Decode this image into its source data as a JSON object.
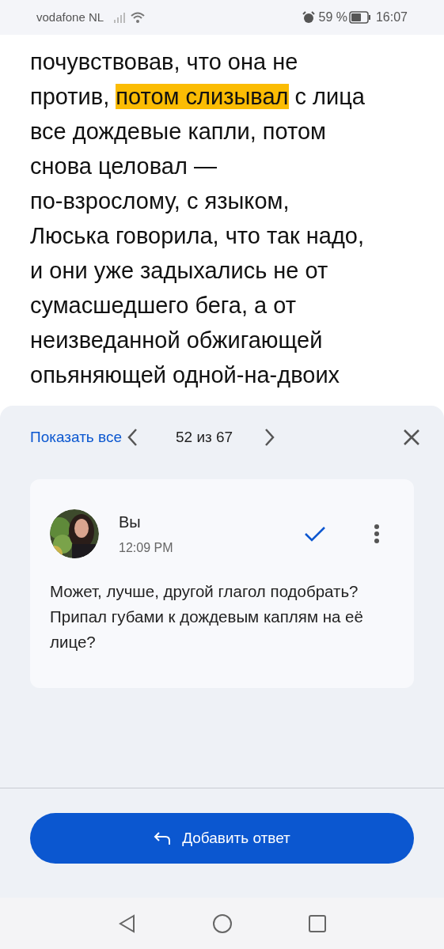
{
  "status_bar": {
    "carrier": "vodafone NL",
    "battery": "59 %",
    "time": "16:07"
  },
  "document": {
    "lines": [
      [
        {
          "text": "почувствовав, что она не",
          "highlighted": false
        }
      ],
      [
        {
          "text": "против, ",
          "highlighted": false
        },
        {
          "text": "потом слизывал",
          "highlighted": true
        },
        {
          "text": " с лица",
          "highlighted": false
        }
      ],
      [
        {
          "text": "все дождевые капли, потом",
          "highlighted": false
        }
      ],
      [
        {
          "text": "снова целовал —",
          "highlighted": false
        }
      ],
      [
        {
          "text": "по-взрослому, с языком,",
          "highlighted": false
        }
      ],
      [
        {
          "text": "Люська говорила, что так надо,",
          "highlighted": false
        }
      ],
      [
        {
          "text": "и они уже задыхались не от",
          "highlighted": false
        }
      ],
      [
        {
          "text": "сумасшедшего бега, а от",
          "highlighted": false
        }
      ],
      [
        {
          "text": "неизведанной обжигающей",
          "highlighted": false
        }
      ],
      [
        {
          "text": "опьяняющей одной-на-двоих",
          "highlighted": false
        }
      ]
    ]
  },
  "comments_panel": {
    "show_all": "Показать все",
    "counter": "52 из 67",
    "comment": {
      "author": "Вы",
      "time": "12:09 PM",
      "text": "Может, лучше, другой глагол подобрать? Припал губами к дождевым каплям на её лице?"
    },
    "reply_button": "Добавить ответ"
  }
}
